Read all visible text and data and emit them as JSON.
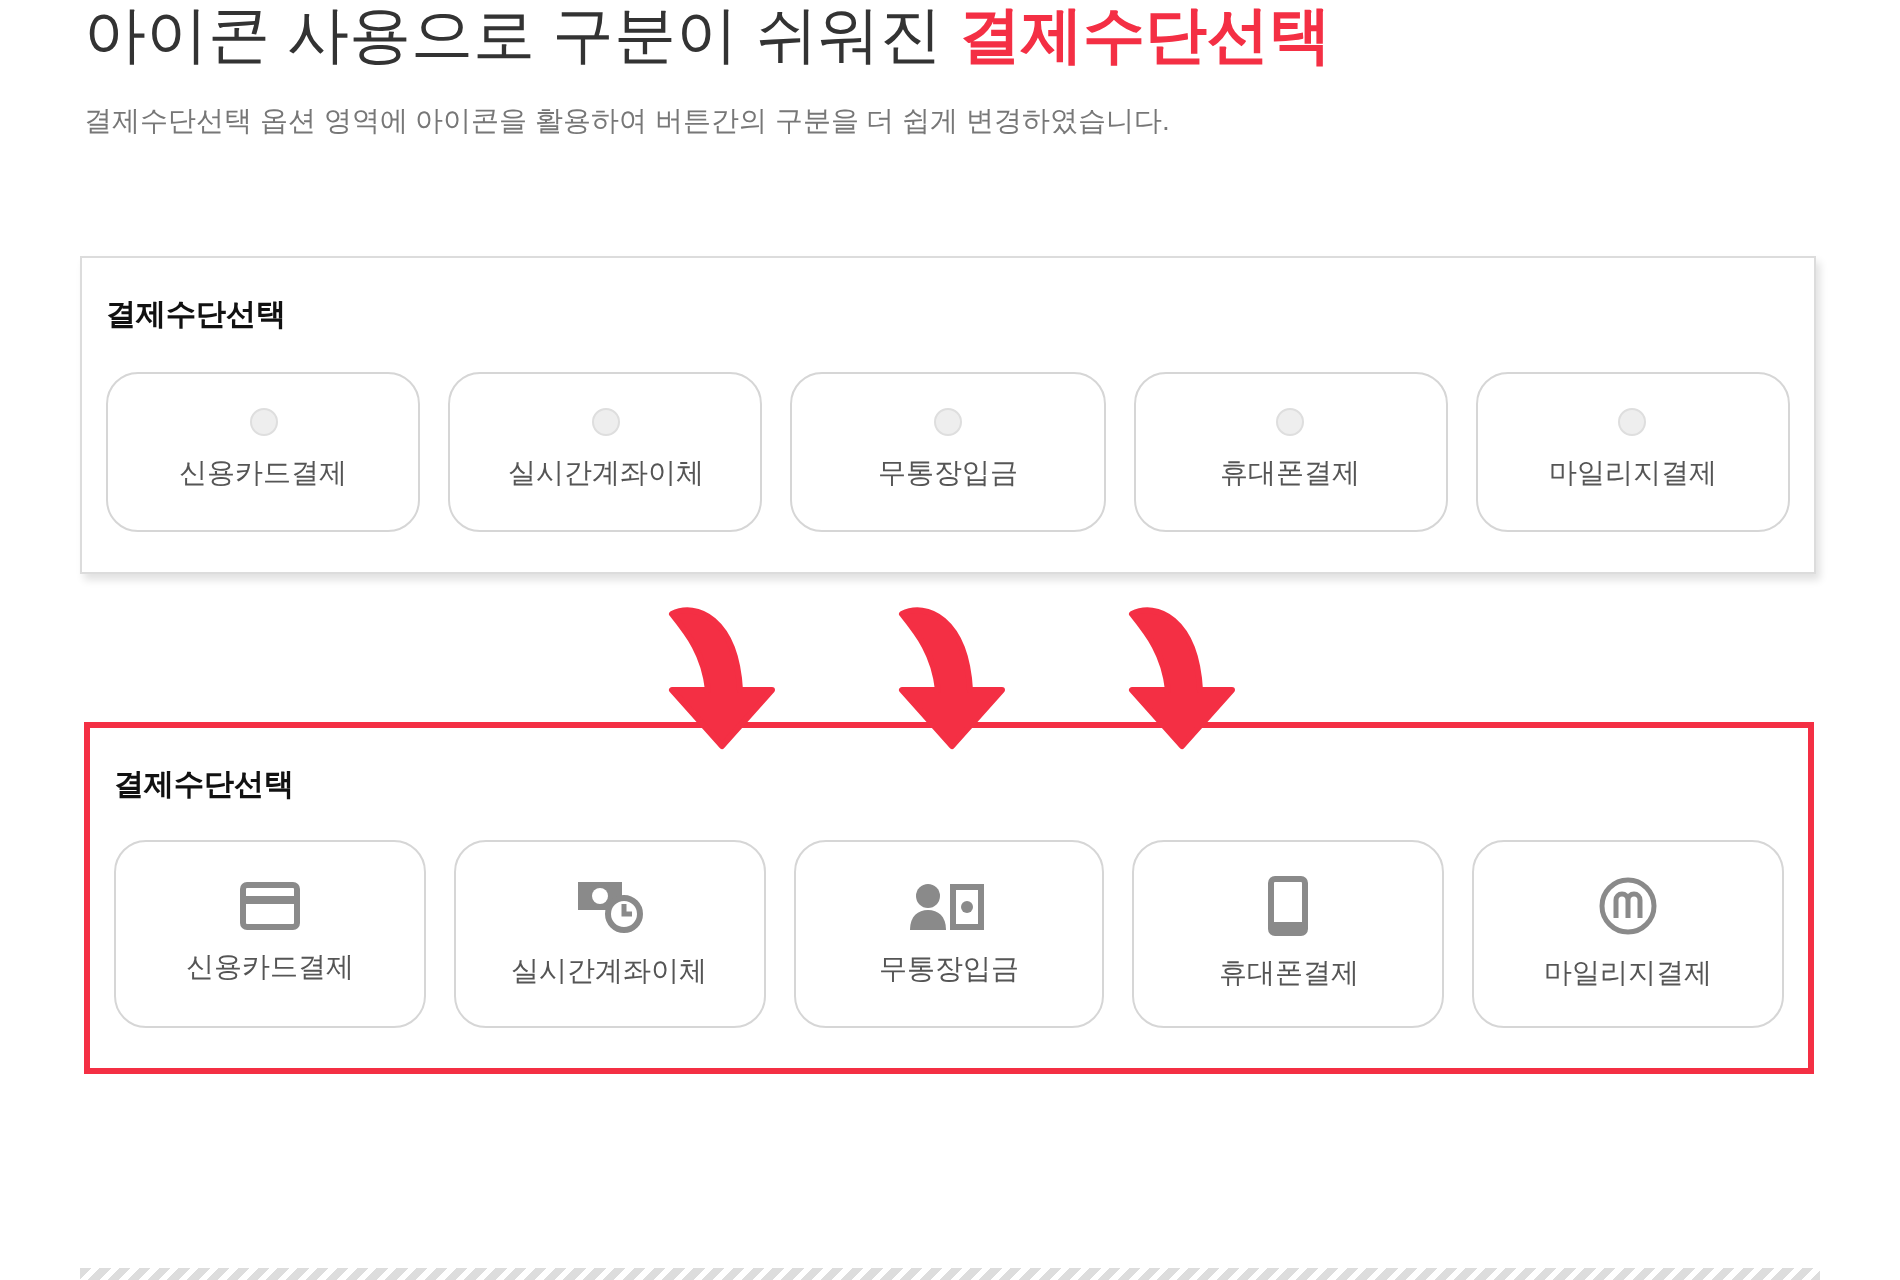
{
  "heading": {
    "text": "아이콘 사용으로 구분이 쉬워진 ",
    "accent": "결제수단선택"
  },
  "description": "결제수단선택 옵션 영역에 아이콘을 활용하여 버튼간의 구분을 더 쉽게 변경하였습니다.",
  "panels": [
    {
      "kind": "radio",
      "highlighted": false,
      "title": "결제수단선택",
      "options": [
        "신용카드결제",
        "실시간계좌이체",
        "무통장입금",
        "휴대폰결제",
        "마일리지결제"
      ]
    },
    {
      "kind": "icon",
      "highlighted": true,
      "title": "결제수단선택",
      "options": [
        "신용카드결제",
        "실시간계좌이체",
        "무통장입금",
        "휴대폰결제",
        "마일리지결제"
      ]
    }
  ]
}
